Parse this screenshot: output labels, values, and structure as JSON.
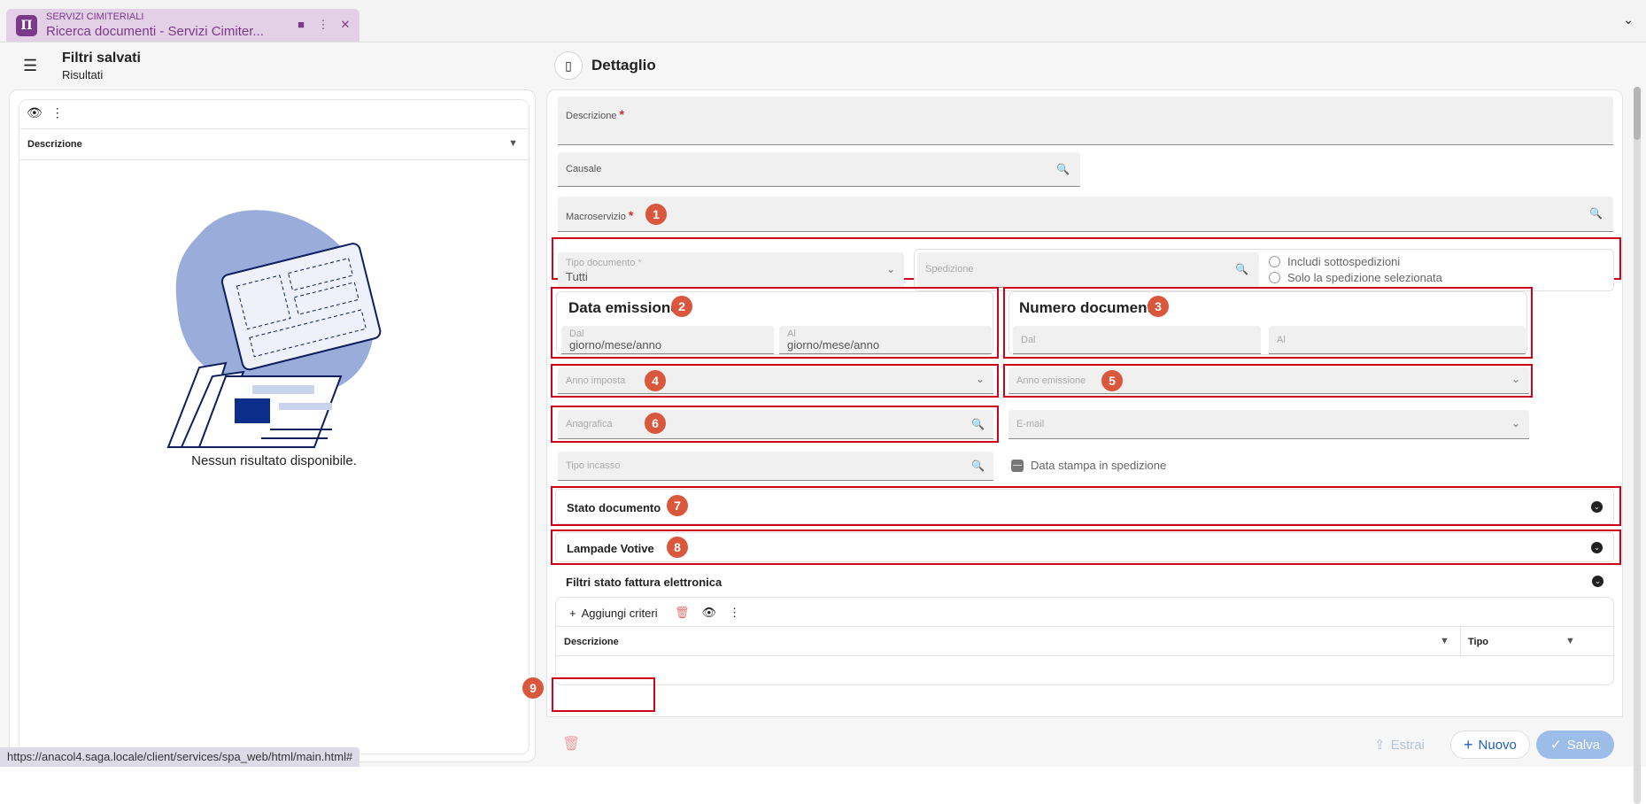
{
  "tab": {
    "subtitle": "SERVIZI CIMITERIALI",
    "title": "Ricerca documenti - Servizi Cimiter..."
  },
  "left": {
    "title": "Filtri salvati",
    "subtitle": "Risultati",
    "column": "Descrizione",
    "empty": "Nessun risultato disponibile."
  },
  "right": {
    "title": "Dettaglio"
  },
  "form": {
    "descrizione": "Descrizione",
    "causale": "Causale",
    "macroservizio": "Macroservizio",
    "tipo_documento": {
      "label": "Tipo documento",
      "value": "Tutti"
    },
    "spedizione": "Spedizione",
    "radio1": "Includi sottospedizioni",
    "radio2": "Solo la spedizione selezionata",
    "data_emissione": {
      "title": "Data emissione",
      "dal": "Dal",
      "al": "Al",
      "dal_ph": "giorno/mese/anno",
      "al_ph": "giorno/mese/anno"
    },
    "numero_documento": {
      "title": "Numero documento",
      "dal": "Dal",
      "al": "Al"
    },
    "anno_imposta": "Anno imposta",
    "anno_emissione": "Anno emissione",
    "anagrafica": "Anagrafica",
    "email": "E-mail",
    "tipo_incasso": "Tipo incasso",
    "data_stampa": "Data stampa in spedizione",
    "acc1": "Stato documento",
    "acc2": "Lampade Votive",
    "acc3": "Filtri stato fattura elettronica"
  },
  "criteria": {
    "add": "Aggiungi criteri",
    "col1": "Descrizione",
    "col2": "Tipo"
  },
  "footer": {
    "estrai": "Estrai",
    "nuovo": "Nuovo",
    "salva": "Salva"
  },
  "badges": [
    "1",
    "2",
    "3",
    "4",
    "5",
    "6",
    "7",
    "8",
    "9"
  ],
  "status_url": "https://anacol4.saga.locale/client/services/spa_web/html/main.html#",
  "colors": {
    "accent": "#7a3a8a",
    "highlight": "#d0021b",
    "badge": "#d9573c",
    "save": "#9bbde8",
    "primary": "#1f5fbf"
  }
}
